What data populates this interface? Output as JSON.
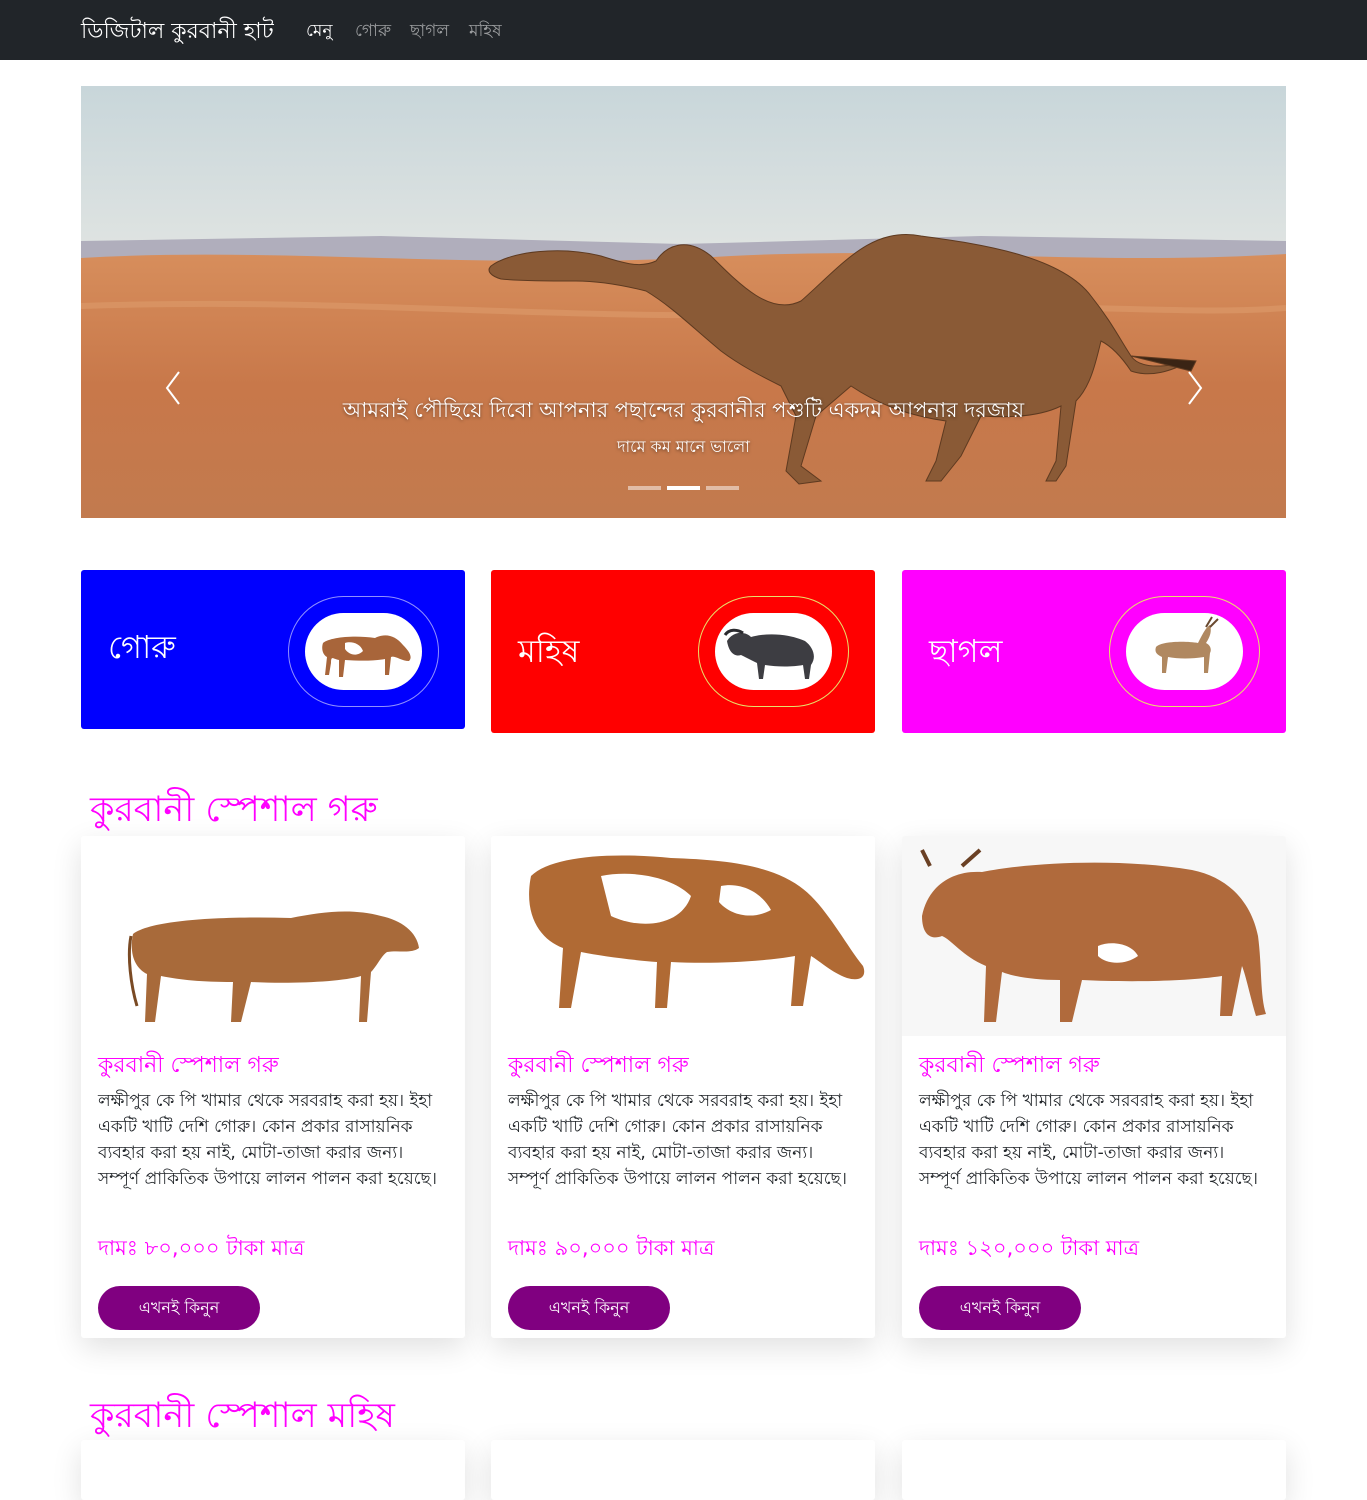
{
  "navbar": {
    "brand": "ডিজিটাল কুরবানী হাট",
    "items": [
      {
        "label": "মেনু",
        "active": true
      },
      {
        "label": "গোরু",
        "active": false
      },
      {
        "label": "ছাগল",
        "active": false
      },
      {
        "label": "মহিষ",
        "active": false
      }
    ]
  },
  "carousel": {
    "caption_title": "আমরাই পৌছিয়ে দিবো আপনার পছান্দের কুরবানীর পশুটি একদম আপনার দরজায়",
    "caption_subtitle": "দামে কম মানে ভালো",
    "active_slide": 2,
    "slide_count": 3,
    "prev_icon": "chevron-left-icon",
    "next_icon": "chevron-right-icon"
  },
  "categories": [
    {
      "label": "গোরু",
      "color": "#0000ff",
      "animal": "cow"
    },
    {
      "label": "মহিষ",
      "color": "#ff0000",
      "animal": "buffalo"
    },
    {
      "label": "ছাগল",
      "color": "#ff00ff",
      "animal": "goat"
    }
  ],
  "sections": {
    "cow_title": "কুরবানী স্পেশাল গরু",
    "buffalo_title": "কুরবানী স্পেশাল মহিষ"
  },
  "cow_cards": [
    {
      "title": "কুরবানী স্পেশাল গরু",
      "text": "লক্ষীপুর কে পি খামার থেকে সরবরাহ করা হয়। ইহা একটি খাটি দেশি গোরু। কোন প্রকার রাসায়নিক ব্যবহার করা হয় নাই, মোটা-তাজা করার জন্য। সম্পূর্ণ প্রাকিতিক উপায়ে লালন পালন করা হয়েছে।",
      "price": "দামঃ ৮০,০০০ টাকা মাত্র",
      "button": "এখনই কিনুন"
    },
    {
      "title": "কুরবানী স্পেশাল গরু",
      "text": "লক্ষীপুর কে পি খামার থেকে সরবরাহ করা হয়। ইহা একটি খাটি দেশি গোরু। কোন প্রকার রাসায়নিক ব্যবহার করা হয় নাই, মোটা-তাজা করার জন্য। সম্পূর্ণ প্রাকিতিক উপায়ে লালন পালন করা হয়েছে।",
      "price": "দামঃ ৯০,০০০ টাকা মাত্র",
      "button": "এখনই কিনুন"
    },
    {
      "title": "কুরবানী স্পেশাল গরু",
      "text": "লক্ষীপুর কে পি খামার থেকে সরবরাহ করা হয়। ইহা একটি খাটি দেশি গোরু। কোন প্রকার রাসায়নিক ব্যবহার করা হয় নাই, মোটা-তাজা করার জন্য। সম্পূর্ণ প্রাকিতিক উপায়ে লালন পালন করা হয়েছে।",
      "price": "দামঃ ১২০,০০০ টাকা মাত্র",
      "button": "এখনই কিনুন"
    }
  ],
  "colors": {
    "navbar_bg": "#212529",
    "accent": "#ff00ff",
    "button": "#800080"
  }
}
